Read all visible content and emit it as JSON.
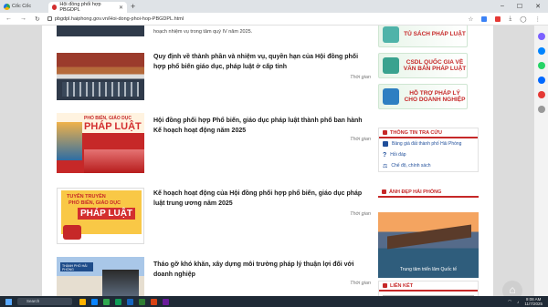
{
  "browser": {
    "brand": "Cốc Cốc",
    "tab_title": "Hội đồng phối hợp PBGDPL",
    "url": "pbgdpl.haiphong.gov.vn/Hoi-dong-phoi-hop-PBGDPL.html"
  },
  "articles": [
    {
      "snippet": "hoạch nhiệm vụ trong tâm quý IV năm 2025."
    },
    {
      "title": "Quy định về thành phần và nhiệm vụ, quyền hạn của Hội đồng phối hợp phổ biến giáo dục, pháp luật ở cấp tỉnh",
      "time": "Thời gian"
    },
    {
      "title": "Hội đồng phối hợp Phổ biến, giáo dục pháp luật thành phố ban hành Kế hoạch hoạt động năm 2025",
      "time": "Thời gian",
      "poster_top": "PHỔ BIẾN, GIÁO DỤC",
      "poster_main": "PHÁP LUẬT"
    },
    {
      "title": "Kế hoạch hoạt động của Hội đồng phối hợp phổ biến, giáo dục  pháp luật trung ương năm 2025",
      "time": "Thời gian",
      "poster_l1": "TUYÊN TRUYỀN",
      "poster_l2": "PHỔ BIẾN, GIÁO DỤC",
      "poster_main": "PHÁP LUẬT"
    },
    {
      "title": "Tháo gỡ khó khăn, xây dựng môi trường pháp lý thuận lợi đối với doanh nghiệp",
      "time": "Thời gian",
      "sign": "THÀNH PHỐ HẢI PHÒNG"
    }
  ],
  "sidebar": {
    "banners": [
      "TỦ SÁCH PHÁP LUẬT",
      "CSDL QUỐC GIA VỀ VĂN BẢN PHÁP LUẬT",
      "HỖ TRỢ PHÁP LÝ CHO DOANH NGHIỆP"
    ],
    "lookup_title": "THÔNG TIN TRA CỨU",
    "lookup_links": [
      "Bảng giá đất thành phố Hải Phòng",
      "Hỏi đáp",
      "Chế độ, chính sách"
    ],
    "gallery_title": "ẢNH ĐẸP HẢI PHÒNG",
    "gallery_caption": "Trung tâm triển lãm Quốc tế",
    "links_title": "LIÊN KẾT",
    "links_select": "--"
  },
  "taskbar": {
    "search_placeholder": "Search",
    "time": "9:08 AM",
    "date": "11/7/2025"
  },
  "colors": {
    "accent_red": "#c62828",
    "link_blue": "#1f4e9a"
  }
}
